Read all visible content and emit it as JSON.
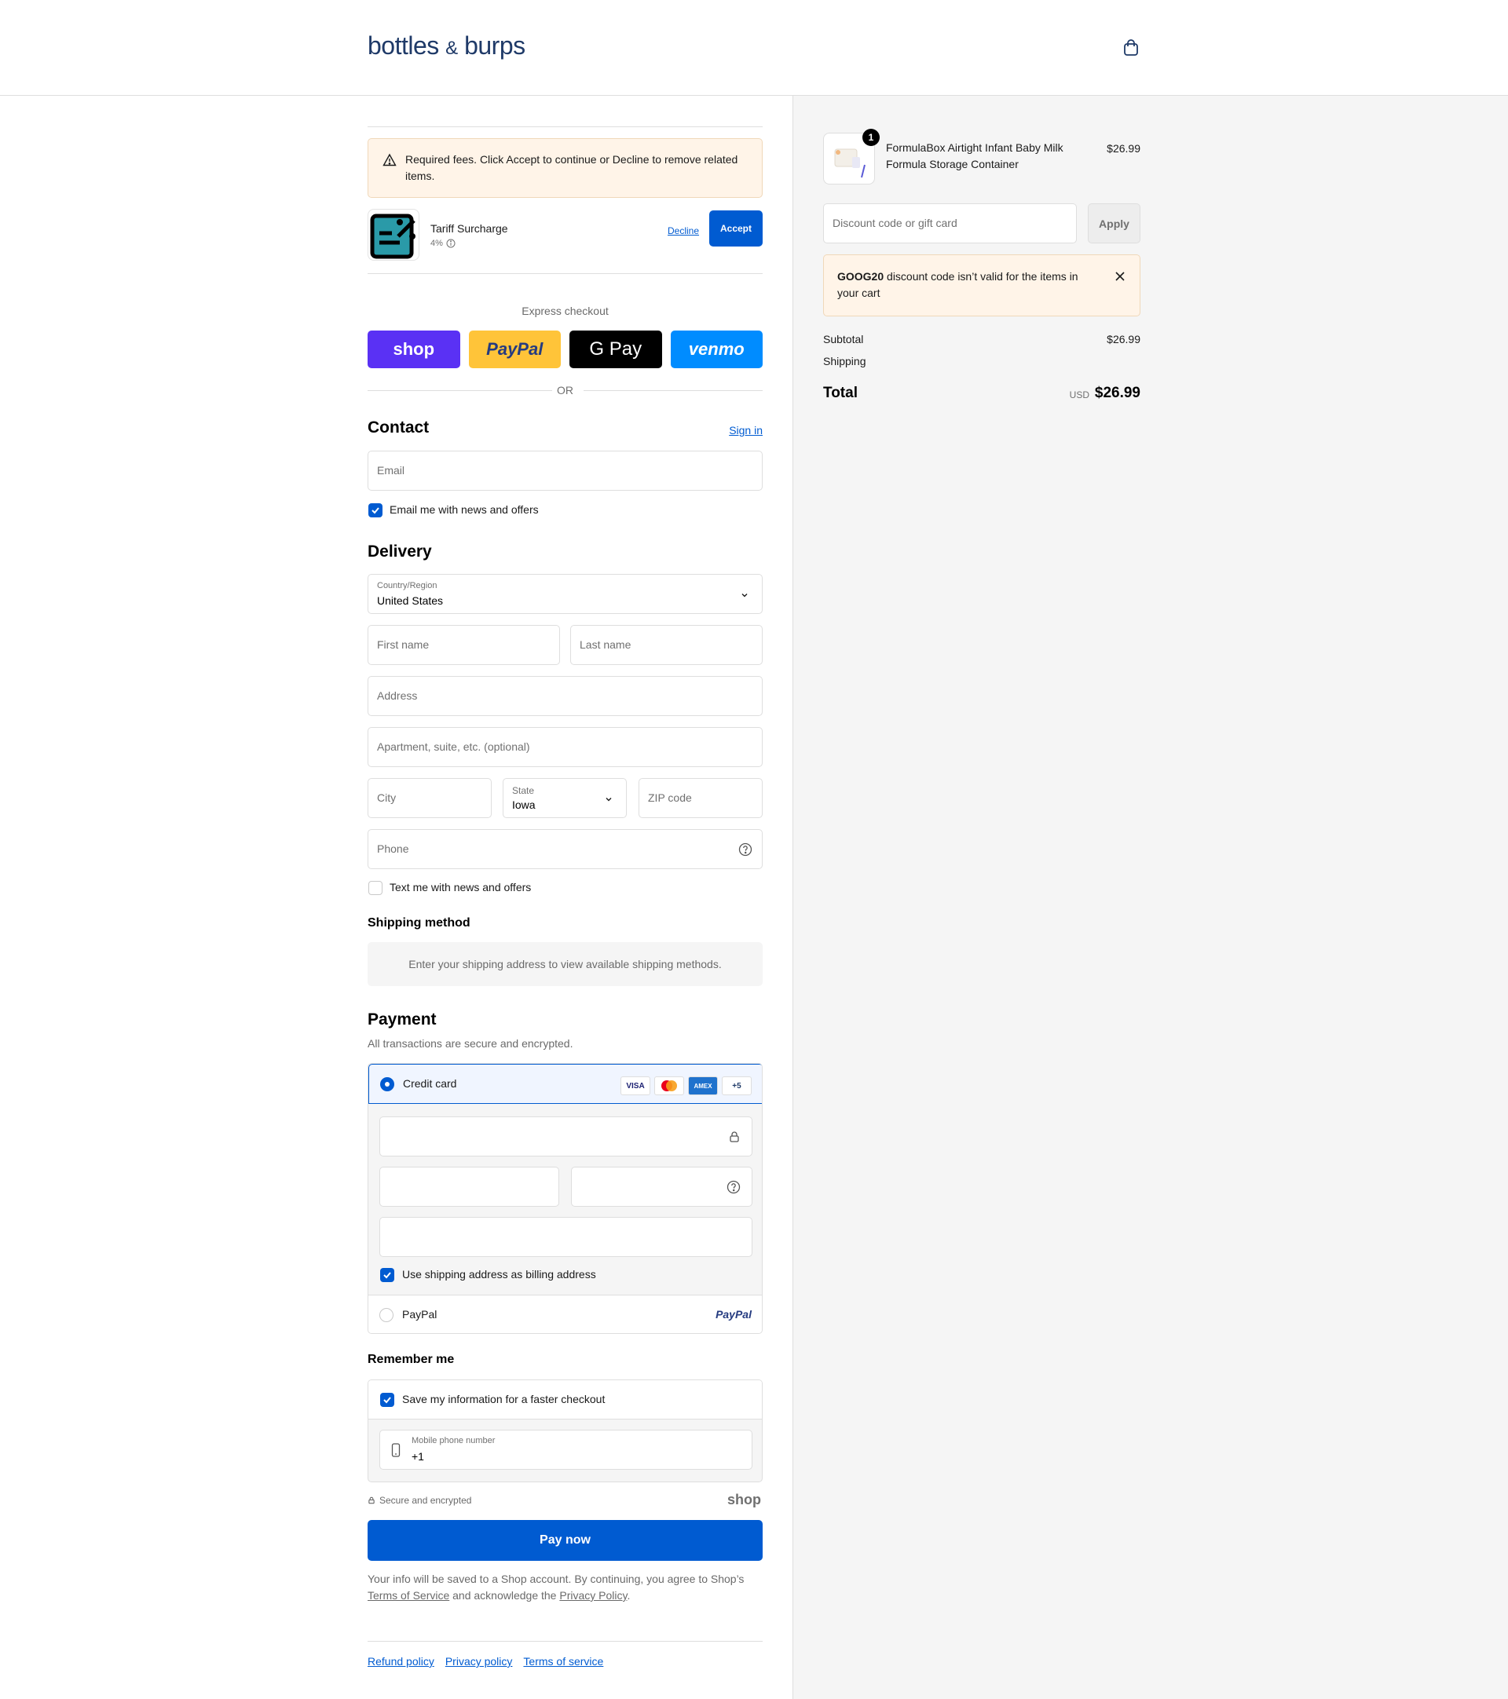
{
  "header": {
    "logo_main": "bottles",
    "logo_amp": "&",
    "logo_tail": "burps",
    "cart_icon": "shopping-bag-icon"
  },
  "fees": {
    "warning": "Required fees. Click Accept to continue or Decline to remove related items.",
    "item_title": "Tariff Surcharge",
    "item_rate": "4%",
    "decline_label": "Decline",
    "accept_label": "Accept"
  },
  "express": {
    "label": "Express checkout",
    "shop": "shop",
    "paypal": "PayPal",
    "gpay": "G Pay",
    "venmo": "venmo",
    "or": "OR"
  },
  "contact": {
    "title": "Contact",
    "sign_in": "Sign in",
    "email_placeholder": "Email",
    "news_label": "Email me with news and offers",
    "news_checked": true
  },
  "delivery": {
    "title": "Delivery",
    "country_label": "Country/Region",
    "country_value": "United States",
    "first_name": "First name",
    "last_name": "Last name",
    "address": "Address",
    "apartment": "Apartment, suite, etc. (optional)",
    "city": "City",
    "state_label": "State",
    "state_value": "Iowa",
    "zip": "ZIP code",
    "phone": "Phone",
    "text_label": "Text me with news and offers",
    "text_checked": false
  },
  "shipping": {
    "title": "Shipping method",
    "info": "Enter your shipping address to view available shipping methods."
  },
  "payment": {
    "title": "Payment",
    "subtitle": "All transactions are secure and encrypted.",
    "credit_card": "Credit card",
    "card_visa": "VISA",
    "card_amex": "AMEX",
    "card_more": "+5",
    "billing_label": "Use shipping address as billing address",
    "paypal_label": "PayPal",
    "paypal_logo": "PayPal"
  },
  "remember": {
    "title": "Remember me",
    "save_label": "Save my information for a faster checkout",
    "phone_label": "Mobile phone number",
    "phone_value": "+1"
  },
  "footer": {
    "secure": "Secure and encrypted",
    "shop_logo": "shop",
    "pay_now": "Pay now",
    "legal_1": "Your info will be saved to a Shop account. By continuing, you agree to Shop’s",
    "terms_link": "Terms of Service",
    "legal_2": "and acknowledge the",
    "privacy_link": "Privacy Policy",
    "legal_3": ".",
    "links": [
      "Refund policy",
      "Privacy policy",
      "Terms of service"
    ]
  },
  "summary": {
    "product_name": "FormulaBox Airtight Infant Baby Milk Formula Storage Container",
    "product_price": "$26.99",
    "quantity": "1",
    "discount_placeholder": "Discount code or gift card",
    "apply_label": "Apply",
    "error_code": "GOOG20",
    "error_text": "discount code isn’t valid for the items in your cart",
    "subtotal_label": "Subtotal",
    "subtotal_value": "$26.99",
    "shipping_label": "Shipping",
    "total_label": "Total",
    "currency": "USD",
    "total_value": "$26.99"
  },
  "colors": {
    "accent": "#005bd1",
    "warning_bg": "#fff4e8",
    "summary_bg": "#f5f5f5"
  }
}
